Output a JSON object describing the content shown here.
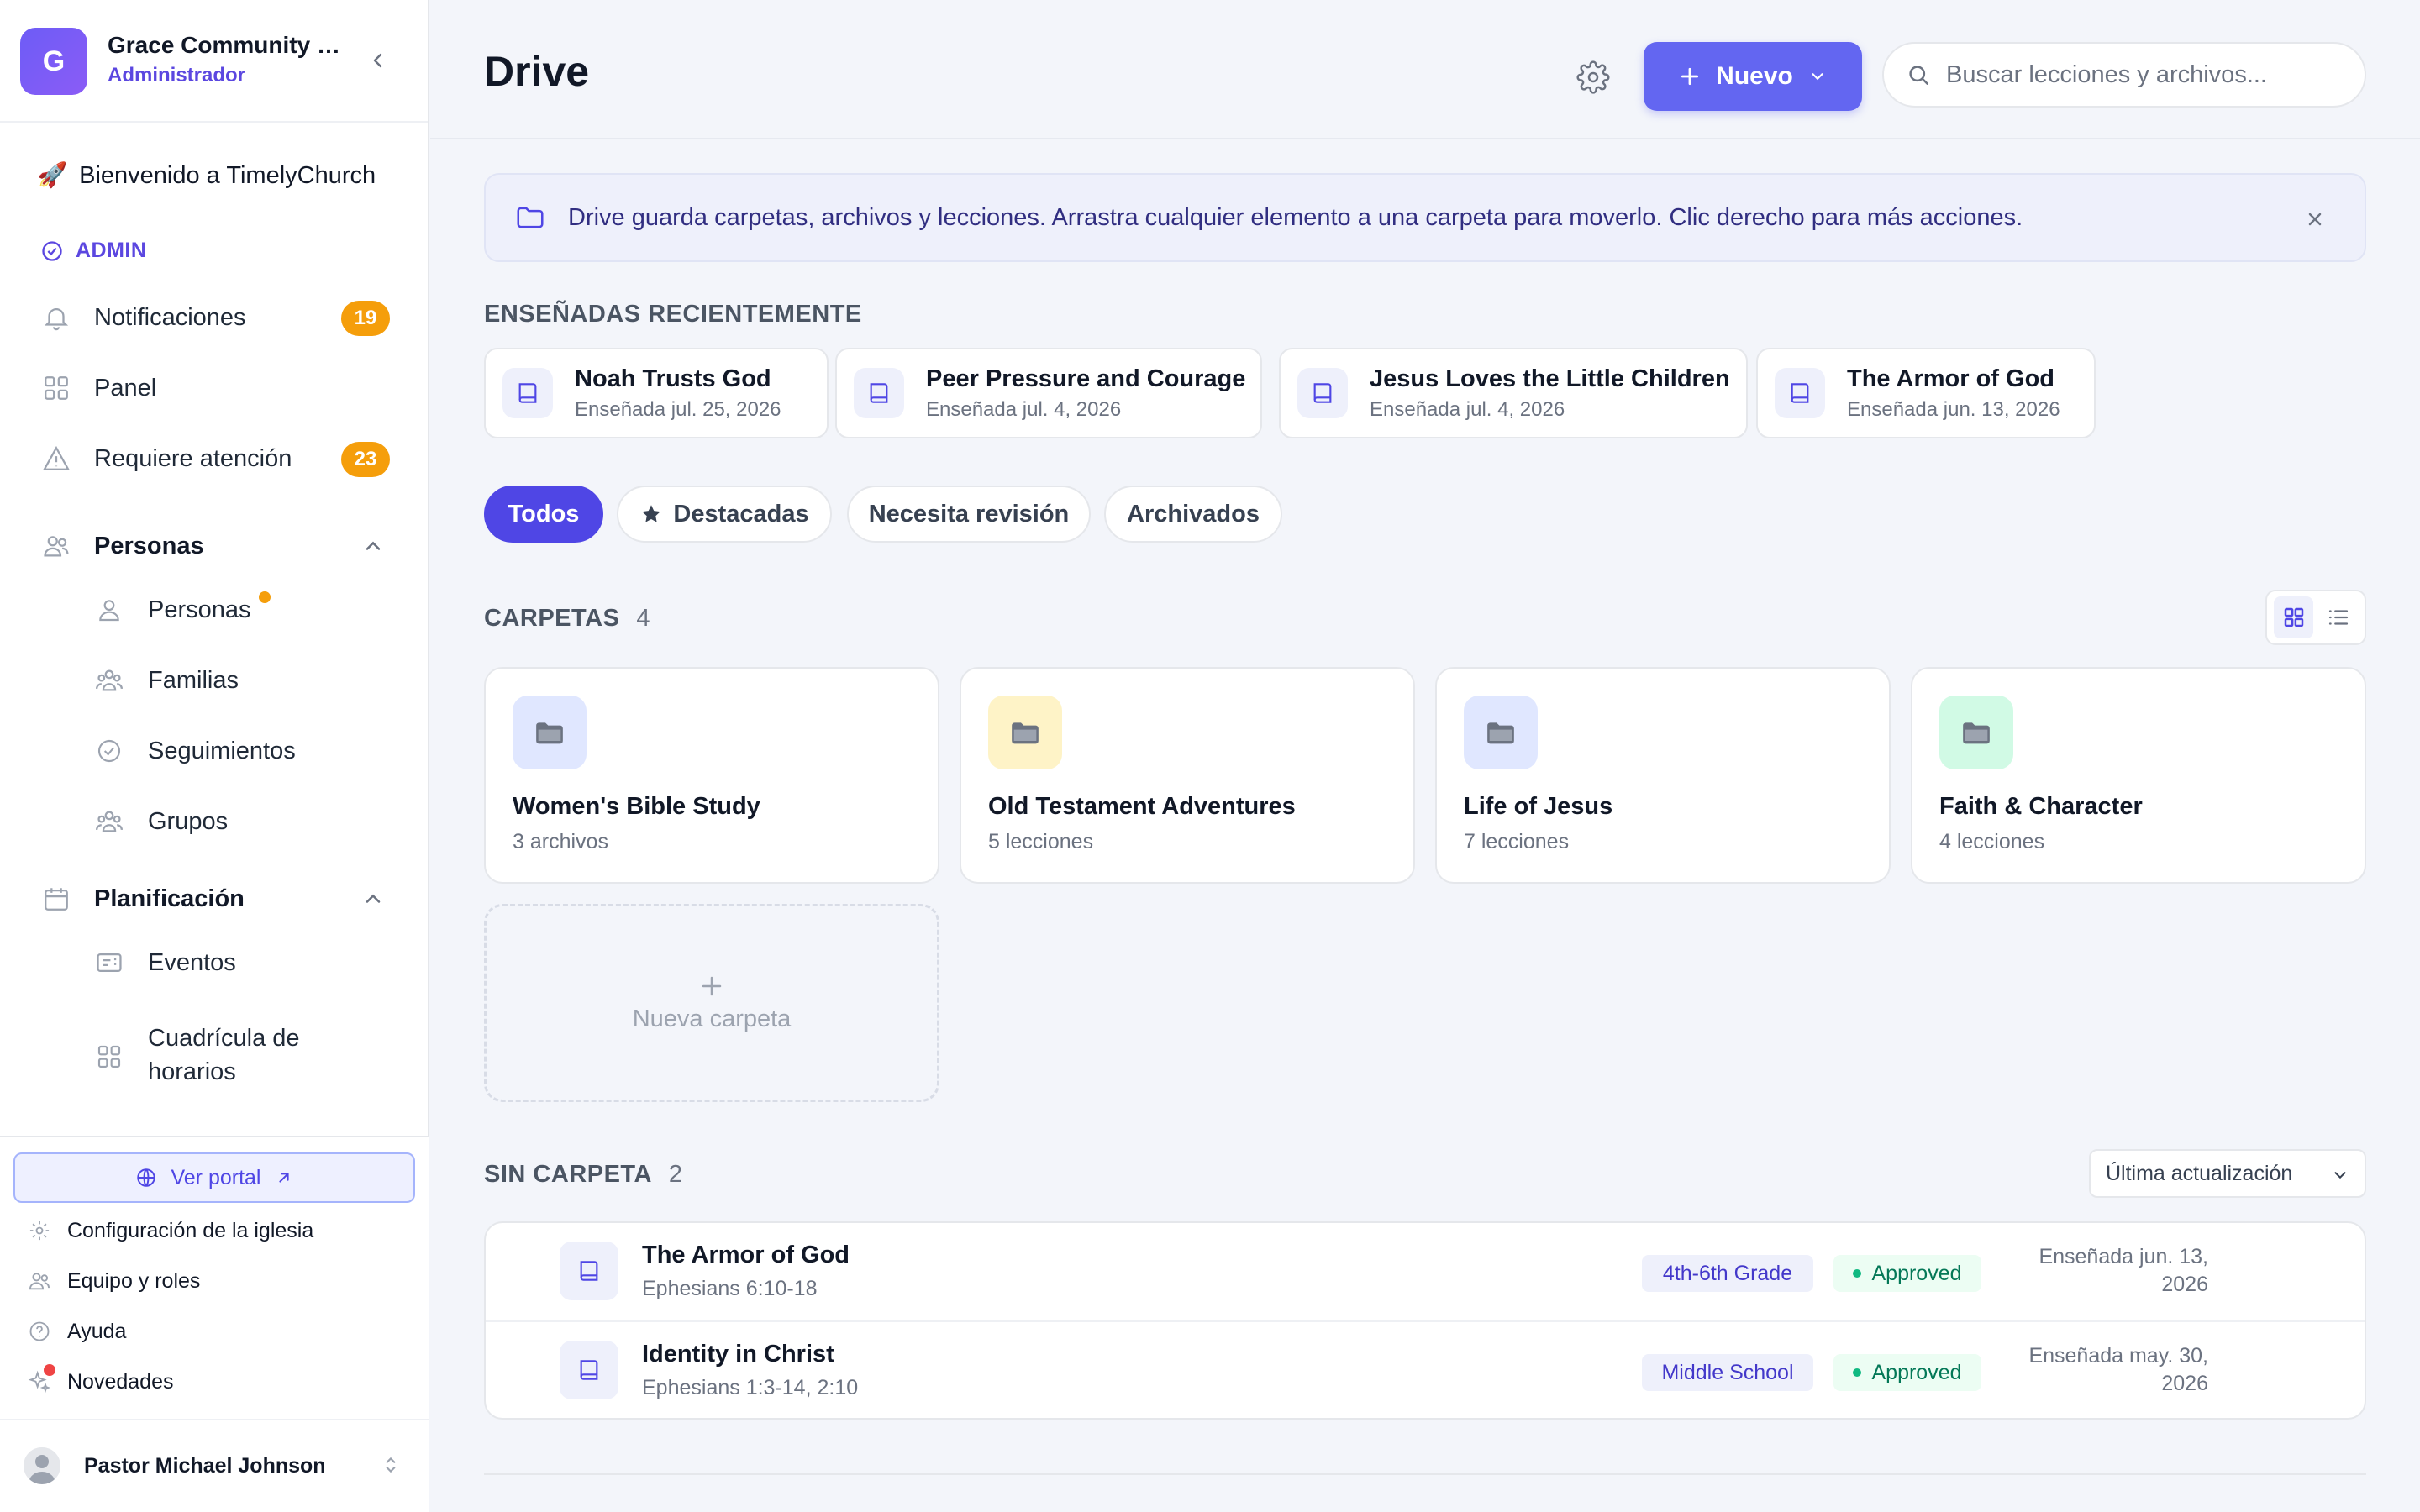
{
  "sidebar": {
    "org_initial": "G",
    "org_name": "Grace Community Church",
    "org_role": "Administrador",
    "welcome": "Bienvenido a TimelyChurch",
    "admin_label": "ADMIN",
    "items": {
      "notifications": {
        "label": "Notificaciones",
        "badge": "19"
      },
      "panel": {
        "label": "Panel"
      },
      "attention": {
        "label": "Requiere atención",
        "badge": "23"
      }
    },
    "people_section": {
      "label": "Personas",
      "items": [
        "Personas",
        "Familias",
        "Seguimientos",
        "Grupos"
      ]
    },
    "planning_section": {
      "label": "Planificación",
      "items": [
        "Eventos",
        "Cuadrícula de horarios"
      ]
    },
    "footer": {
      "portal_button": "Ver portal",
      "links": [
        "Configuración de la iglesia",
        "Equipo y roles",
        "Ayuda",
        "Novedades"
      ],
      "user_name": "Pastor Michael Johnson"
    }
  },
  "header": {
    "title": "Drive",
    "new_button": "Nuevo",
    "search_placeholder": "Buscar lecciones y archivos..."
  },
  "banner": {
    "text": "Drive guarda carpetas, archivos y lecciones. Arrastra cualquier elemento a una carpeta para moverlo. Clic derecho para más acciones."
  },
  "recent": {
    "label": "ENSEÑADAS RECIENTEMENTE",
    "items": [
      {
        "title": "Noah Trusts God",
        "taught": "Enseñada jul. 25, 2026"
      },
      {
        "title": "Peer Pressure and Courage",
        "taught": "Enseñada jul. 4, 2026"
      },
      {
        "title": "Jesus Loves the Little Children",
        "taught": "Enseñada jul. 4, 2026"
      },
      {
        "title": "The Armor of God",
        "taught": "Enseñada jun. 13, 2026"
      }
    ]
  },
  "filters": [
    "Todos",
    "Destacadas",
    "Necesita revisión",
    "Archivados"
  ],
  "folders": {
    "label": "CARPETAS",
    "count": "4",
    "items": [
      {
        "name": "Women's Bible Study",
        "sub": "3 archivos",
        "color": "#e0e7ff"
      },
      {
        "name": "Old Testament Adventures",
        "sub": "5 lecciones",
        "color": "#fef3c7"
      },
      {
        "name": "Life of Jesus",
        "sub": "7 lecciones",
        "color": "#e0e7ff"
      },
      {
        "name": "Faith & Character",
        "sub": "4 lecciones",
        "color": "#d1fae5"
      }
    ],
    "new_folder": "Nueva carpeta"
  },
  "unfiled": {
    "label": "SIN CARPETA",
    "count": "2",
    "sort": "Última actualización",
    "lessons": [
      {
        "title": "The Armor of God",
        "ref": "Ephesians 6:10-18",
        "grade": "4th-6th Grade",
        "status": "Approved",
        "taught_1": "Enseñada jun. 13,",
        "taught_2": "2026"
      },
      {
        "title": "Identity in Christ",
        "ref": "Ephesians 1:3-14, 2:10",
        "grade": "Middle School",
        "status": "Approved",
        "taught_1": "Enseñada may. 30,",
        "taught_2": "2026"
      }
    ]
  },
  "colors": {
    "accent": "#6366f1",
    "badge": "#f59e0b",
    "approved": "#047857"
  }
}
